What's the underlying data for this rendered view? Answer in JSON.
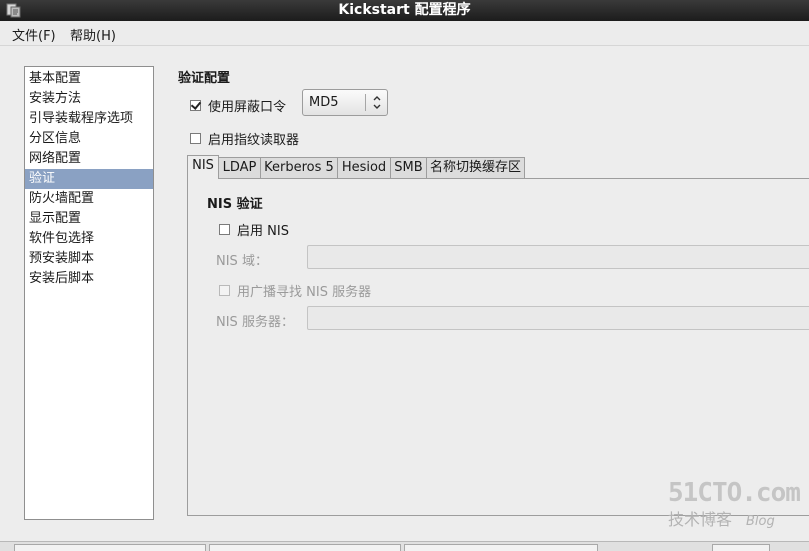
{
  "window": {
    "title": "Kickstart 配置程序"
  },
  "menu": [
    {
      "label": "文件(F)"
    },
    {
      "label": "帮助(H)"
    }
  ],
  "sidebar": {
    "selected_index": 5,
    "items": [
      {
        "label": "基本配置"
      },
      {
        "label": "安装方法"
      },
      {
        "label": "引导装载程序选项"
      },
      {
        "label": "分区信息"
      },
      {
        "label": "网络配置"
      },
      {
        "label": "验证"
      },
      {
        "label": "防火墙配置"
      },
      {
        "label": "显示配置"
      },
      {
        "label": "软件包选择"
      },
      {
        "label": "预安装脚本"
      },
      {
        "label": "安装后脚本"
      }
    ]
  },
  "auth": {
    "title": "验证配置",
    "shadow_label": "使用屏蔽口令",
    "shadow_checked": true,
    "hash_value": "MD5",
    "fingerprint_label": "启用指纹读取器",
    "fingerprint_checked": false
  },
  "tabs": [
    {
      "label": "NIS"
    },
    {
      "label": "LDAP"
    },
    {
      "label": "Kerberos 5"
    },
    {
      "label": "Hesiod"
    },
    {
      "label": "SMB"
    },
    {
      "label": "名称切换缓存区"
    }
  ],
  "nis": {
    "heading": "NIS 验证",
    "enable_label": "启用 NIS",
    "enable_checked": false,
    "domain_label": "NIS 域：",
    "domain_value": "",
    "broadcast_label": "用广播寻找 NIS 服务器",
    "server_label": "NIS 服务器：",
    "server_value": ""
  },
  "watermark": {
    "main": "51CTO.com",
    "sub": "技术博客",
    "blog": "Blog"
  }
}
